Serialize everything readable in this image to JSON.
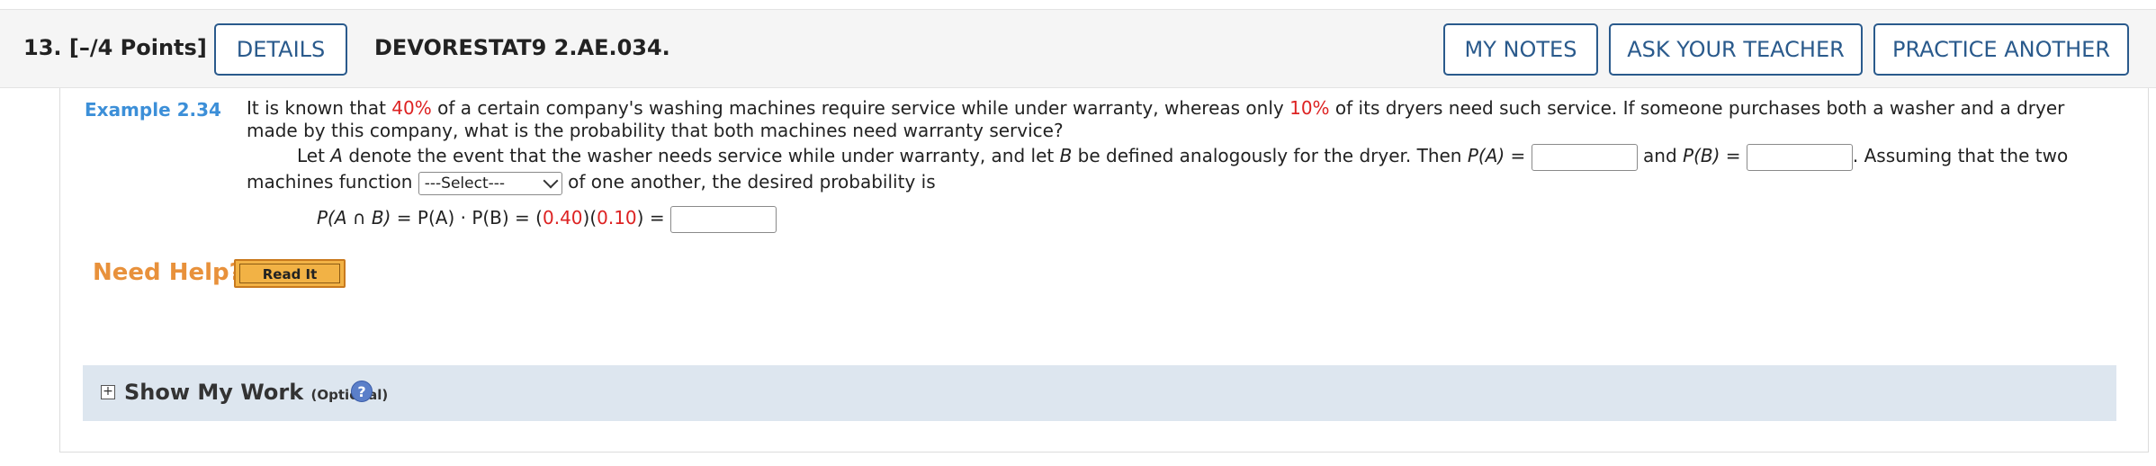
{
  "header": {
    "question_number": "13.",
    "points": "[–/4 Points]",
    "details_label": "DETAILS",
    "problem_code": "DEVORESTAT9 2.AE.034.",
    "my_notes_label": "MY NOTES",
    "ask_teacher_label": "ASK YOUR TEACHER",
    "practice_another_label": "PRACTICE ANOTHER"
  },
  "example": {
    "label": "Example 2.34",
    "intro_1": "It is known that ",
    "pct_washer": "40%",
    "intro_2": " of a certain company's washing machines require service while under warranty, whereas only ",
    "pct_dryer": "10%",
    "intro_3": " of its dryers need such service. If someone purchases both a washer and a dryer made by this company, what is the probability that both machines need warranty service?",
    "let_1": "Let ",
    "var_a": "A",
    "let_2": " denote the event that the washer needs service while under warranty, and let ",
    "var_b": "B",
    "let_3": " be defined analogously for the dryer. Then ",
    "pa": "P(A)",
    "eq": " = ",
    "and_text": " and ",
    "pb": "P(B)",
    "assume_text": ". Assuming that the two",
    "machines_text": "machines function ",
    "select_value": "---Select---",
    "after_select": " of one another, the desired probability is",
    "eq_lhs": "P(A ∩ B)",
    "eq_mid": " = P(A) · P(B) = (",
    "val1": "0.40",
    "paren_mid": ")(",
    "val2": "0.10",
    "eq_end": ") ="
  },
  "help": {
    "label": "Need Help?",
    "read_it_label": "Read It"
  },
  "work": {
    "plus_symbol": "+",
    "title": "Show My Work",
    "optional": "(Optional)",
    "help_symbol": "?"
  },
  "colors": {
    "accent_blue": "#2a5a8c",
    "example_blue": "#3c8fd8",
    "red_values": "#dd2222",
    "help_orange": "#e8913b",
    "work_bg": "#dde6ef"
  }
}
